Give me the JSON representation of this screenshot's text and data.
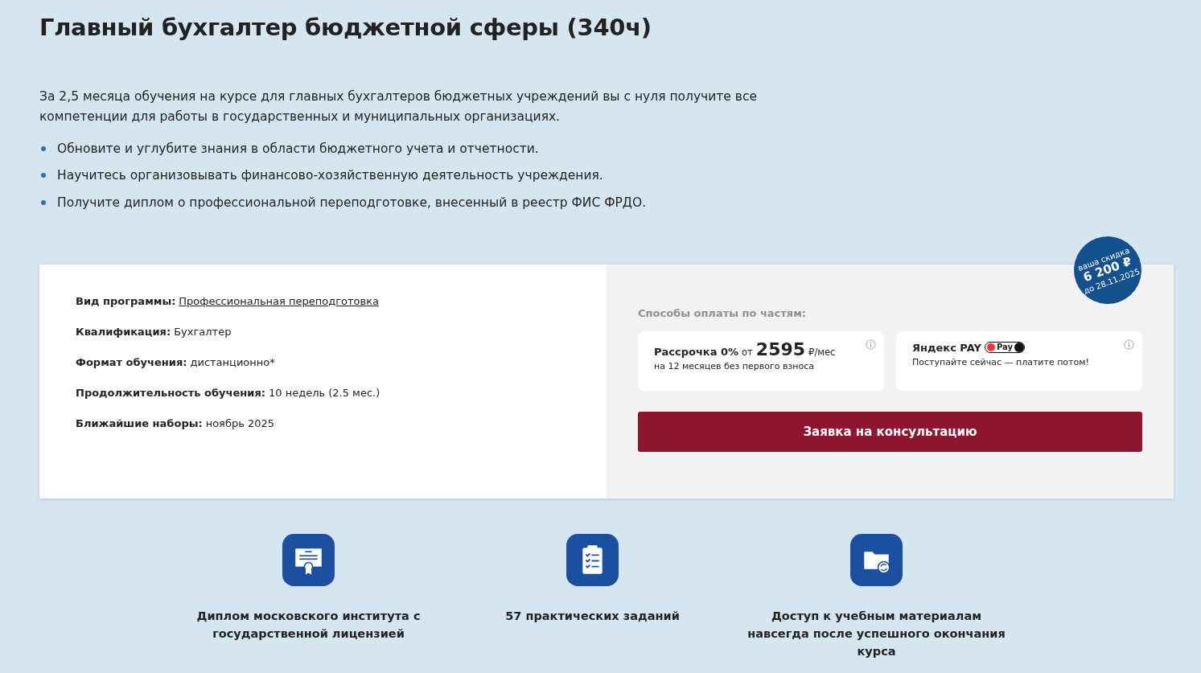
{
  "title": "Главный бухгалтер бюджетной сферы (340ч)",
  "intro": "За 2,5 месяца обучения на курсе для главных бухгалтеров бюджетных учреждений вы с нуля получите все компетенции для работы в государственных и муниципальных организациях.",
  "bullets": [
    "Обновите и углубите знания в области бюджетного учета и отчетности.",
    "Научитесь организовывать финансово-хозяйственную деятельность учреждения.",
    "Получите диплом о профессиональной переподготовке, внесенный в реестр ФИС ФРДО."
  ],
  "details": [
    {
      "label": "Вид программы:",
      "value": "Профессиональная переподготовка",
      "kind": "link"
    },
    {
      "label": "Квалификация:",
      "value": "Бухгалтер",
      "kind": "text"
    },
    {
      "label": "Формат обучения:",
      "value": "дистанционно*",
      "kind": "text"
    },
    {
      "label": "Продолжительность обучения:",
      "value": "10 недель (2.5 мес.)",
      "kind": "text"
    },
    {
      "label": "Ближайшие наборы:",
      "value": "ноябрь 2025",
      "kind": "text"
    }
  ],
  "discount_badge": {
    "line_1": "ваша скидка",
    "amount": "6 200 ₽",
    "until": "до 28.11.2025"
  },
  "payment": {
    "heading": "Способы оплаты по частям:",
    "options": [
      {
        "kind": "installment",
        "name": "Рассрочка 0%",
        "from": "от",
        "price": "2595",
        "unit": "₽/мес",
        "note": "на 12 месяцев без первого взноса"
      },
      {
        "kind": "yandex",
        "name": "Яндекс PAY",
        "logo_text": "Pay",
        "note": "Поступайте сейчас — платите потом!"
      }
    ],
    "button": "Заявка на консультацию"
  },
  "features": [
    {
      "kind": "diploma",
      "text": "Диплом московского института с государственной лицензией"
    },
    {
      "kind": "checklist",
      "text": "57 практических заданий"
    },
    {
      "kind": "folder",
      "text": "Доступ к учебным материалам навсегда после успешного окончания курса"
    }
  ]
}
